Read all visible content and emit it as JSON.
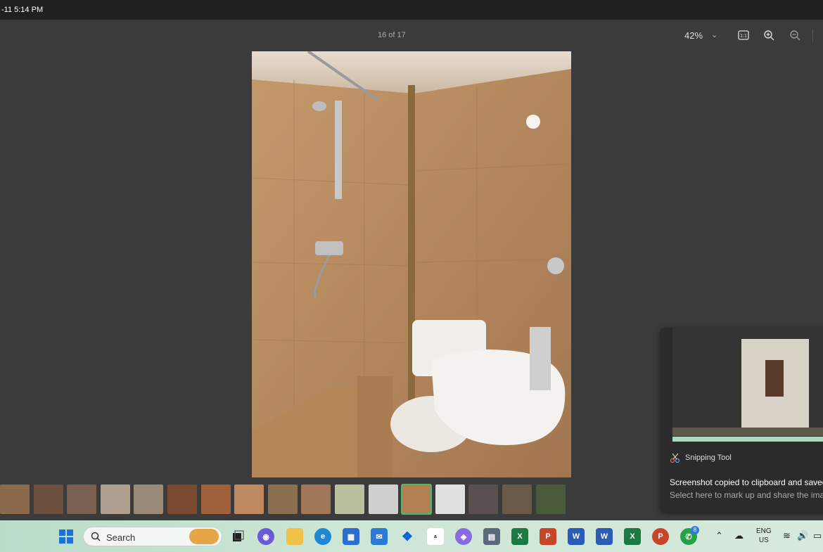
{
  "titlebar": {
    "time": "-11 5:14 PM"
  },
  "viewer": {
    "counter": "16 of 17",
    "zoom": "42%",
    "actual_size_label": "1:1"
  },
  "filmstrip": {
    "active_index": 12,
    "thumb_colors": [
      "#8a6a4a",
      "#6b5040",
      "#7a6050",
      "#b0a090",
      "#9a8a78",
      "#7a4a30",
      "#a0603a",
      "#c08a60",
      "#8a7050",
      "#a07858",
      "#b8c0a0",
      "#cfcfcf",
      "#b08050",
      "#e0e0e0",
      "#5a5050",
      "#6a5a48",
      "#4a5a3a"
    ]
  },
  "toast": {
    "app": "Snipping Tool",
    "title": "Screenshot copied to clipboard and saved",
    "subtitle": "Select here to mark up and share the image"
  },
  "taskbar": {
    "search_placeholder": "Search",
    "whatsapp_badge": "8",
    "lang_top": "ENG",
    "lang_bottom": "US",
    "excel_label": "X",
    "word_label": "W",
    "powerpoint_label": "P"
  }
}
